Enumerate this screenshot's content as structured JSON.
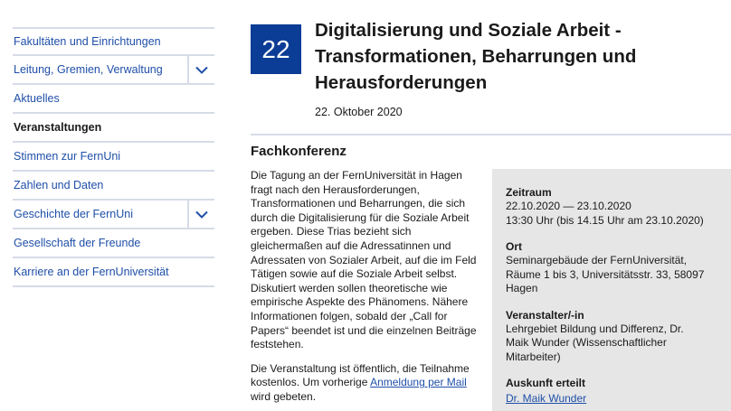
{
  "sidebar": {
    "items": [
      {
        "label": "Fakultäten und Einrichtungen"
      },
      {
        "label": "Leitung, Gremien, Verwaltung"
      },
      {
        "label": "Aktuelles"
      },
      {
        "label": "Veranstaltungen"
      },
      {
        "label": "Stimmen zur FernUni"
      },
      {
        "label": "Zahlen und Daten"
      },
      {
        "label": "Geschichte der FernUni"
      },
      {
        "label": "Gesellschaft der Freunde"
      },
      {
        "label": "Karriere an der FernUniversität"
      }
    ],
    "toggle_icon": "chevron-down-icon",
    "accent_color": "#1f4fa8"
  },
  "event": {
    "day": "22",
    "title": "Digitalisierung und Soziale Arbeit - Transformationen, Beharrungen und Herausforderungen",
    "date": "22. Oktober 2020",
    "badge_color": "#0c3d96"
  },
  "content": {
    "subtitle": "Fachkonferenz",
    "paragraph1": "Die Tagung an der FernUniversität in Hagen fragt nach den Herausforderungen, Transformationen und Beharrungen, die sich durch die Digitalisierung für die Soziale Arbeit ergeben. Diese Trias bezieht sich gleichermaßen auf die Adressatinnen und Adressaten von Sozialer Arbeit, auf die im Feld Tätigen sowie auf die Soziale Arbeit selbst. Diskutiert werden sollen theoretische wie empirische Aspekte des Phänomens. Nähere Informationen folgen, sobald der „Call for Papers“ beendet ist und die einzelnen Beiträge feststehen.",
    "paragraph2_start": "Die Veranstaltung ist öffentlich, die Teilnahme kostenlos. Um vorherige ",
    "paragraph2_link": "Anmeldung per Mail",
    "paragraph2_end": " wird gebeten."
  },
  "info": {
    "zeitraum_label": "Zeitraum",
    "zeitraum_line1": "22.10.2020 — 23.10.2020",
    "zeitraum_line2": "13:30 Uhr (bis 14.15 Uhr am 23.10.2020)",
    "ort_label": "Ort",
    "ort_line1": "Seminargebäude der FernUniversität,",
    "ort_line2": "Räume 1 bis 3, Universitätsstr. 33, 58097",
    "ort_line3": "Hagen",
    "veranstalter_label": "Veranstalter/-in",
    "veranstalter_line1": "Lehrgebiet Bildung und Differenz, Dr.",
    "veranstalter_line2": "Maik Wunder (Wissenschaftlicher",
    "veranstalter_line3": "Mitarbeiter)",
    "auskunft_label": "Auskunft erteilt",
    "auskunft_link": "Dr. Maik Wunder"
  }
}
